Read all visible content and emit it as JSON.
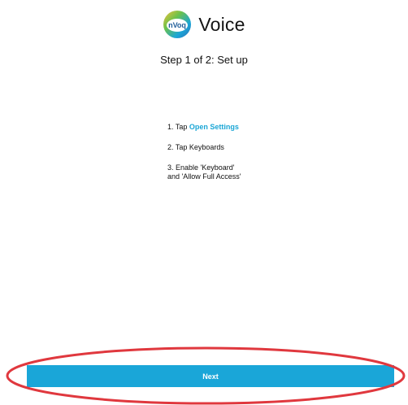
{
  "app": {
    "logo_text": "nVoq",
    "title": "Voice"
  },
  "step": {
    "title": "Step 1 of 2: Set up"
  },
  "instructions": {
    "step1_prefix": "1. Tap ",
    "step1_link": "Open Settings",
    "step2": "2. Tap Keyboards",
    "step3_line1": "3. Enable 'Keyboard'",
    "step3_line2": "and 'Allow Full Access'"
  },
  "footer": {
    "next_label": "Next"
  },
  "colors": {
    "accent": "#1aa6d8",
    "highlight": "#e0383e"
  },
  "icons": {
    "logo": "nvoq-logo-icon"
  }
}
